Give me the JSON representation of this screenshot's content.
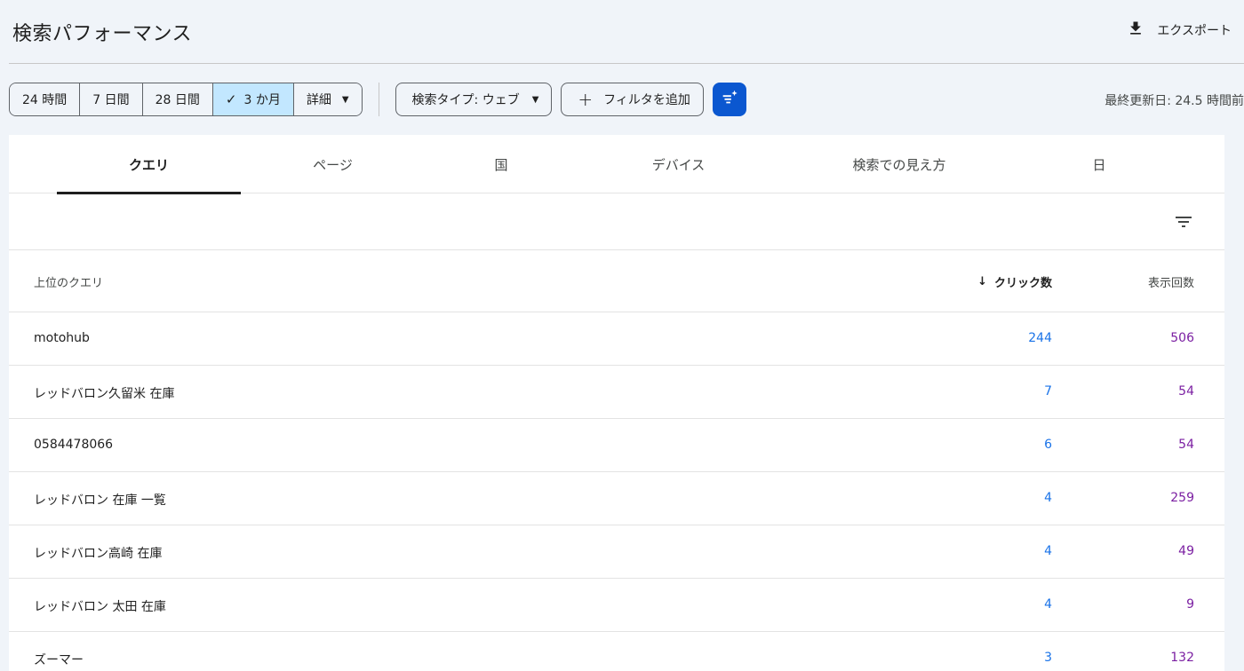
{
  "header": {
    "title": "検索パフォーマンス",
    "export_label": "エクスポート"
  },
  "toolbar": {
    "date_ranges": [
      {
        "label": "24 時間",
        "active": false
      },
      {
        "label": "7 日間",
        "active": false
      },
      {
        "label": "28 日間",
        "active": false
      },
      {
        "label": "3 か月",
        "active": true
      },
      {
        "label": "詳細",
        "active": false
      }
    ],
    "search_type": "検索タイプ: ウェブ",
    "add_filter": "フィルタを追加",
    "last_updated": "最終更新日: 24.5 時間前"
  },
  "tabs": [
    {
      "label": "クエリ",
      "active": true
    },
    {
      "label": "ページ",
      "active": false
    },
    {
      "label": "国",
      "active": false
    },
    {
      "label": "デバイス",
      "active": false
    },
    {
      "label": "検索での見え方",
      "active": false
    },
    {
      "label": "日",
      "active": false
    }
  ],
  "table": {
    "col_query": "上位のクエリ",
    "col_clicks": "クリック数",
    "col_impressions": "表示回数",
    "rows": [
      {
        "query": "motohub",
        "clicks": "244",
        "impressions": "506"
      },
      {
        "query": "レッドバロン久留米 在庫",
        "clicks": "7",
        "impressions": "54"
      },
      {
        "query": "0584478066",
        "clicks": "6",
        "impressions": "54"
      },
      {
        "query": "レッドバロン 在庫 一覧",
        "clicks": "4",
        "impressions": "259"
      },
      {
        "query": "レッドバロン高崎 在庫",
        "clicks": "4",
        "impressions": "49"
      },
      {
        "query": "レッドバロン 太田 在庫",
        "clicks": "4",
        "impressions": "9"
      },
      {
        "query": "ズーマー",
        "clicks": "3",
        "impressions": "132"
      }
    ]
  },
  "colors": {
    "clicks": "#1a73e8",
    "impressions": "#7b1fa2",
    "accent": "#0b57d0",
    "active_segment": "#c2e7ff"
  }
}
